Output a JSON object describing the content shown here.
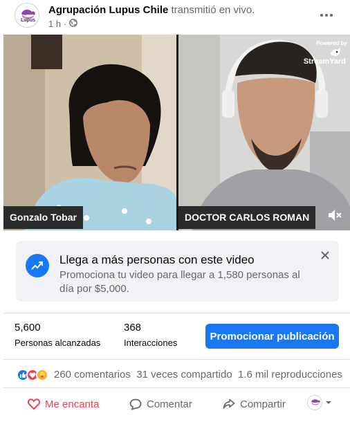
{
  "post": {
    "page_name": "Agrupación Lupus Chile",
    "action_text": "transmitió en vivo.",
    "time": "1 h",
    "separator": "·",
    "privacy_icon": "globe-icon",
    "avatar_text": "Lupus",
    "more_icon": "more-dots-icon"
  },
  "video": {
    "left_name": "Gonzalo Tobar",
    "right_name": "DOCTOR CARLOS ROMAN",
    "powered_by": "Powered by",
    "brand": "StreamYard",
    "mute_icon": "speaker-muted-icon"
  },
  "promo": {
    "title": "Llega a más personas con este video",
    "description": "Promociona tu video para llegar a 1,580 personas al día por $5,000.",
    "icon": "trending-up-icon",
    "close_icon": "close-icon"
  },
  "insights": {
    "reach_value": "5,600",
    "reach_label": "Personas alcanzadas",
    "engagement_value": "368",
    "engagement_label": "Interacciones",
    "promote_button": "Promocionar publicación"
  },
  "engagement": {
    "reactions": [
      "like",
      "love",
      "care"
    ],
    "comments": "260 comentarios",
    "shares": "31 veces compartido",
    "views": "1.6 mil reproducciones"
  },
  "actions": {
    "love_label": "Me encanta",
    "comment_label": "Comentar",
    "share_label": "Compartir"
  },
  "colors": {
    "brand_blue": "#1877f2",
    "love_red": "#f33e58",
    "secondary_text": "#65676b"
  }
}
